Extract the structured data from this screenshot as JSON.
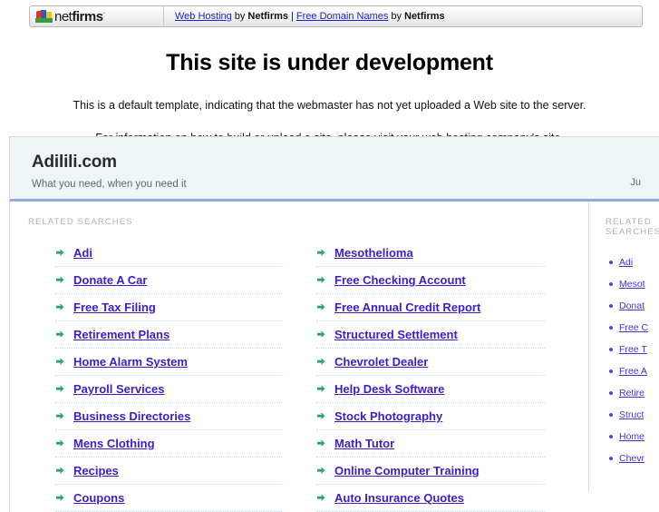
{
  "netfirms_bar": {
    "logo_text_light": "net",
    "logo_text_bold": "firms",
    "trademark": "·",
    "link1": "Web Hosting",
    "by1": "by",
    "brand1": "Netfirms",
    "separator": "|",
    "link2": "Free Domain Names",
    "by2": "by",
    "brand2": "Netfirms"
  },
  "development_notice": {
    "title": "This site is under development",
    "paragraph1": "This is a default template, indicating that the webmaster has not yet uploaded a Web site to the server.",
    "paragraph2": "For information on how to build or upload a site, please visit your web hosting company's site."
  },
  "parked_panel": {
    "brand_name": "Adilili.com",
    "tagline": "What you need, when you need it",
    "header_right_text": "Ju",
    "related_searches_label": "RELATED SEARCHES",
    "sidebar_related_label": "RELATED SEARCHES",
    "terms_column_left": [
      "Adi",
      "Donate A Car",
      "Free Tax Filing",
      "Retirement Plans",
      "Home Alarm System",
      "Payroll Services",
      "Business Directories",
      "Mens Clothing",
      "Recipes",
      "Coupons"
    ],
    "terms_column_right": [
      "Mesothelioma",
      "Free Checking Account",
      "Free Annual Credit Report",
      "Structured Settlement",
      "Chevrolet Dealer",
      "Help Desk Software",
      "Stock Photography",
      "Math Tutor",
      "Online Computer Training",
      "Auto Insurance Quotes"
    ],
    "sidebar_terms": [
      "Adi",
      "Mesot",
      "Donat",
      "Free C",
      "Free T",
      "Free A",
      "Retire",
      "Struct",
      "Home",
      "Chevr"
    ]
  },
  "colors": {
    "link_blue": "#3a1ecc",
    "header_bg": "#eff5f7",
    "header_rule": "#93aadd",
    "arrow_green": "#2f9e6e",
    "dotted_rule": "#c4d6f0",
    "muted_label": "#a8b0b6"
  }
}
